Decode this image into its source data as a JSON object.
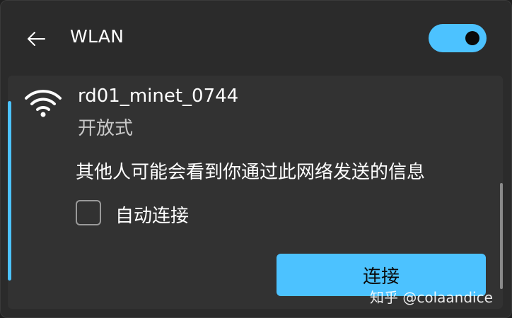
{
  "header": {
    "back_icon": "arrow-left-icon",
    "title": "WLAN",
    "toggle_state": "on"
  },
  "network": {
    "signal_icon": "wifi-signal-icon",
    "ssid": "rd01_minet_0744",
    "security": "开放式",
    "warning": "其他人可能会看到你通过此网络发送的信息",
    "auto_connect_label": "自动连接",
    "auto_connect_checked": false,
    "connect_label": "连接"
  },
  "watermark": {
    "text": "知乎 @colaandice"
  },
  "colors": {
    "accent": "#4cc2ff",
    "background": "#2b2b2b",
    "card": "#323232"
  }
}
